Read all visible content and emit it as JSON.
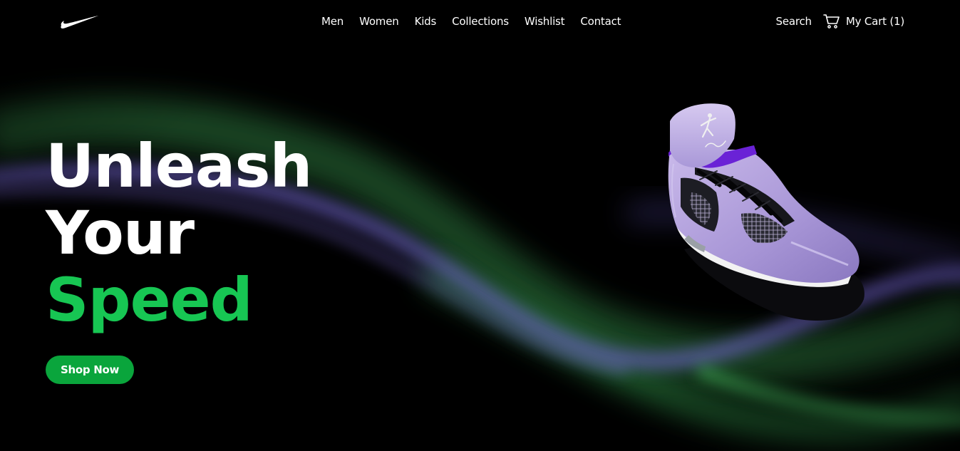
{
  "brand": {
    "logo_icon": "swoosh-logo-icon"
  },
  "nav": {
    "items": [
      {
        "label": "Men"
      },
      {
        "label": "Women"
      },
      {
        "label": "Kids"
      },
      {
        "label": "Collections"
      },
      {
        "label": "Wishlist"
      },
      {
        "label": "Contact"
      }
    ],
    "search_label": "Search",
    "cart_label": "My Cart (1)",
    "cart_icon": "cart-icon"
  },
  "hero": {
    "line1": "Unleash",
    "line2": "Your",
    "line3": "Speed",
    "cta_label": "Shop Now",
    "product_image": "sneaker-image"
  },
  "colors": {
    "background": "#000000",
    "accent_green": "#17c653",
    "button_green": "#0aa53c",
    "smoke_purple": "#7a6bd6",
    "smoke_green": "#3fbf5a"
  }
}
